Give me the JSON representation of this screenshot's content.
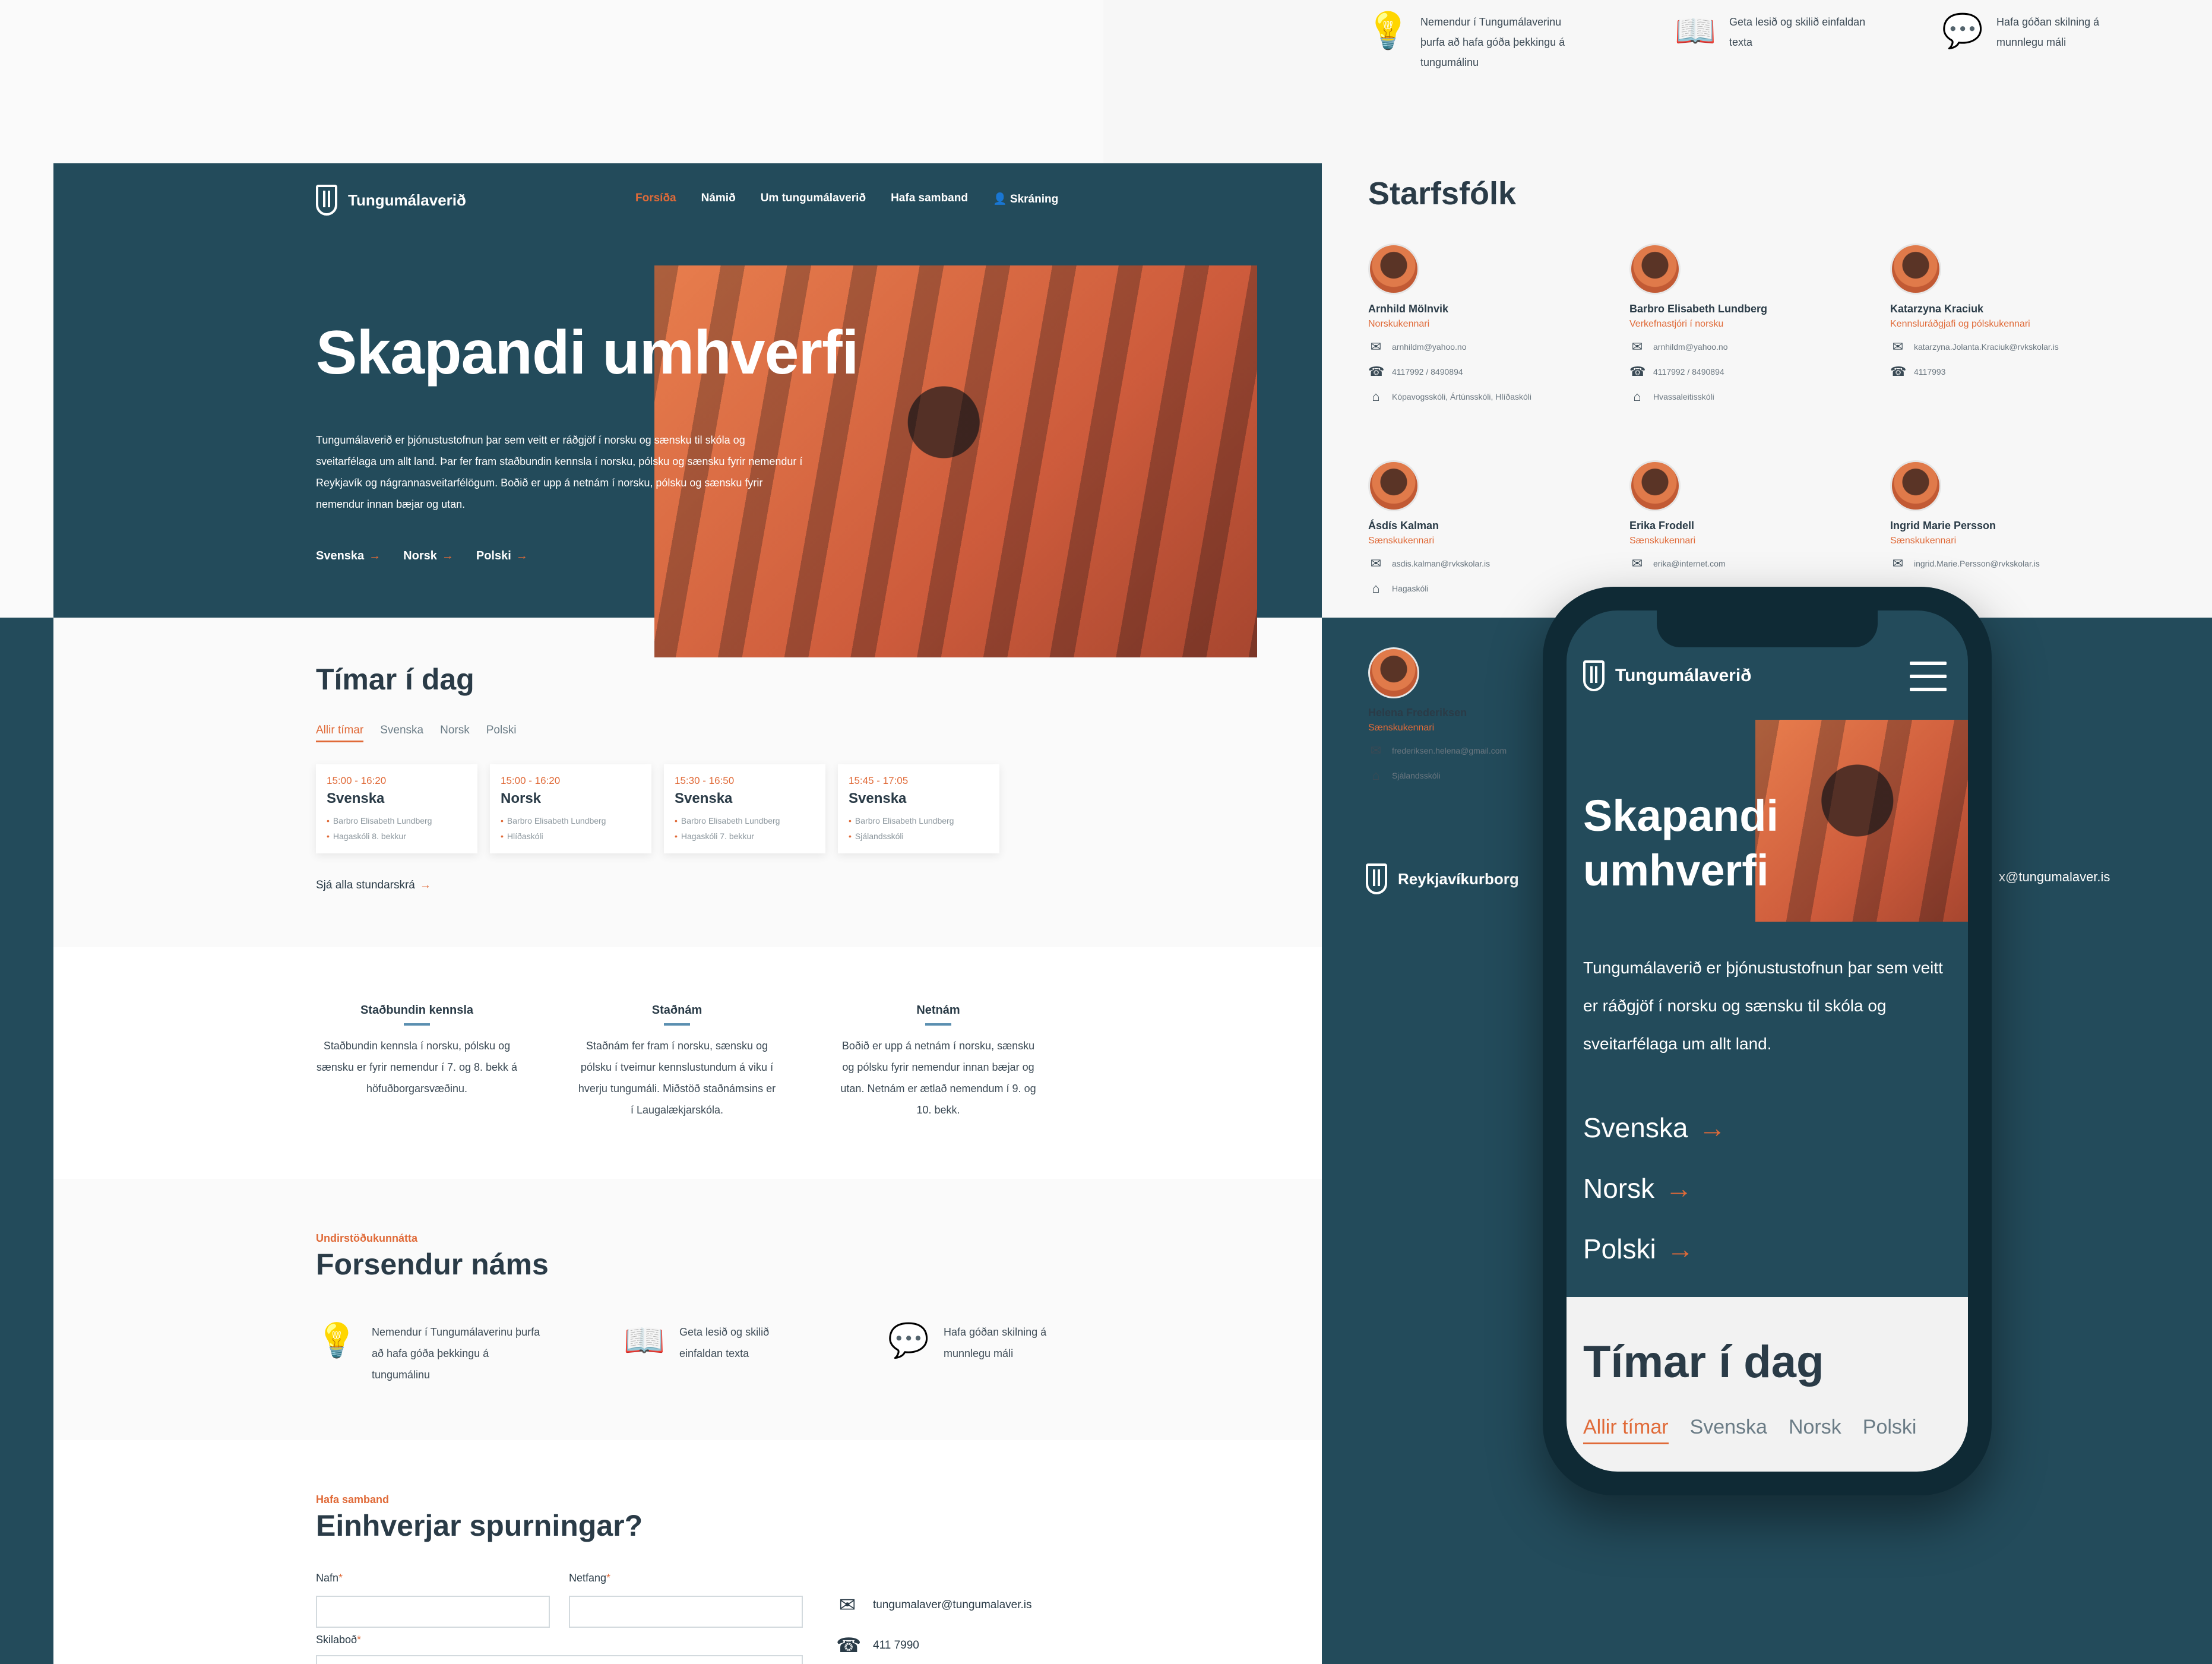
{
  "brand": {
    "name": "Tungumálaverið"
  },
  "nav": {
    "items": [
      "Forsíða",
      "Námið",
      "Um tungumálaverið",
      "Hafa samband",
      "Skráning"
    ]
  },
  "hero": {
    "title": "Skapandi umhverfi",
    "text": "Tungumálaverið er þjónustustofnun þar sem veitt er ráðgjöf í norsku og sænsku til skóla og sveitarfélaga um allt land. Þar fer fram staðbundin kennsla í norsku, pólsku og sænsku fyrir nemendur í Reykjavík og nágrannasveitarfélögum. Boðið er upp á netnám í norsku, pólsku og sænsku fyrir nemendur innan bæjar og utan.",
    "links": [
      "Svenska",
      "Norsk",
      "Polski"
    ]
  },
  "today": {
    "title": "Tímar í dag",
    "tabs": [
      "Allir tímar",
      "Svenska",
      "Norsk",
      "Polski"
    ],
    "cards": [
      {
        "time": "15:00 - 16:20",
        "lang": "Svenska",
        "teacher": "Barbro Elisabeth Lundberg",
        "place": "Hagaskóli 8. bekkur"
      },
      {
        "time": "15:00 - 16:20",
        "lang": "Norsk",
        "teacher": "Barbro Elisabeth Lundberg",
        "place": "Hlíðaskóli"
      },
      {
        "time": "15:30 - 16:50",
        "lang": "Svenska",
        "teacher": "Barbro Elisabeth Lundberg",
        "place": "Hagaskóli 7. bekkur"
      },
      {
        "time": "15:45 - 17:05",
        "lang": "Svenska",
        "teacher": "Barbro Elisabeth Lundberg",
        "place": "Sjálandsskóli"
      }
    ],
    "see_all": "Sjá alla stundarskrá"
  },
  "modes": [
    {
      "title": "Staðbundin kennsla",
      "text": "Staðbundin kennsla í norsku, pólsku og sænsku er fyrir nemendur í 7. og 8. bekk á höfuðborgarsvæðinu."
    },
    {
      "title": "Staðnám",
      "text": "Staðnám fer fram í norsku, sænsku og pólsku í tveimur kennslustundum á viku í hverju tungumáli. Miðstöð staðnámsins er í Laugalækjarskóla."
    },
    {
      "title": "Netnám",
      "text": "Boðið er upp á netnám í norsku, sænsku og pólsku fyrir nemendur innan bæjar og utan. Netnám er ætlað nemendum í 9. og 10. bekk."
    }
  ],
  "prereq": {
    "kicker": "Undirstöðukunnátta",
    "title": "Forsendur náms",
    "items": [
      "Nemendur í Tungumálaverinu þurfa að hafa góða þekkingu á tungumálinu",
      "Geta lesið og skilið einfaldan texta",
      "Hafa góðan skilning á munnlegu máli"
    ]
  },
  "contact": {
    "kicker": "Hafa samband",
    "title": "Einhverjar spurningar?",
    "name_label": "Nafn",
    "email_label": "Netfang",
    "message_label": "Skilaboð",
    "required": "*",
    "email": "tungumalaver@tungumalaver.is",
    "phone": "411 7990"
  },
  "staff": {
    "title": "Starfsfólk",
    "people": [
      {
        "name": "Arnhild Mölnvik",
        "role": "Norskukennari",
        "email": "arnhildm@yahoo.no",
        "phone": "4117992 / 8490894",
        "school": "Kópavogsskóli, Ártúnsskóli, Hlíðaskóli"
      },
      {
        "name": "Barbro Elisabeth Lundberg",
        "role": "Verkefnastjóri í norsku",
        "email": "arnhildm@yahoo.no",
        "phone": "4117992 / 8490894",
        "school": "Hvassaleitisskóli"
      },
      {
        "name": "Katarzyna Kraciuk",
        "role": "Kennsluráðgjafi og pólskukennari",
        "email": "katarzyna.Jolanta.Kraciuk@rvkskolar.is",
        "phone": "4117993"
      },
      {
        "name": "Ásdís Kalman",
        "role": "Sænskukennari",
        "email": "asdis.kalman@rvkskolar.is",
        "school": "Hagaskóli"
      },
      {
        "name": "Erika Frodell",
        "role": "Sænskukennari",
        "email": "erika@internet.com"
      },
      {
        "name": "Ingrid Marie Persson",
        "role": "Sænskukennari",
        "email": "ingrid.Marie.Persson@rvkskolar.is"
      },
      {
        "name": "Helena Frederiksen",
        "role": "Sænskukennari",
        "email": "frederiksen.helena@gmail.com",
        "school": "Sjálandsskóli"
      }
    ]
  },
  "footer": {
    "org": "Reykjavíkurborg",
    "email_partial": "x@tungumalaver.is"
  },
  "mobile": {
    "hero_title_1": "Skapandi",
    "hero_title_2": "umhverfi",
    "hero_text": "Tungumálaverið er þjónustustofnun þar sem veitt er ráðgjöf í norsku og sænsku til skóla og sveitarfélaga um allt land.",
    "today_title": "Tímar í dag"
  },
  "colors": {
    "teal": "#234b5b",
    "accent": "#e06a38"
  },
  "icons": {
    "arrow": "arrow-right-icon",
    "mail": "mail-icon",
    "phone": "phone-icon",
    "home": "home-icon",
    "bulb": "lightbulb-icon",
    "book": "book-icon",
    "chat": "chat-icon",
    "user": "user-icon"
  }
}
